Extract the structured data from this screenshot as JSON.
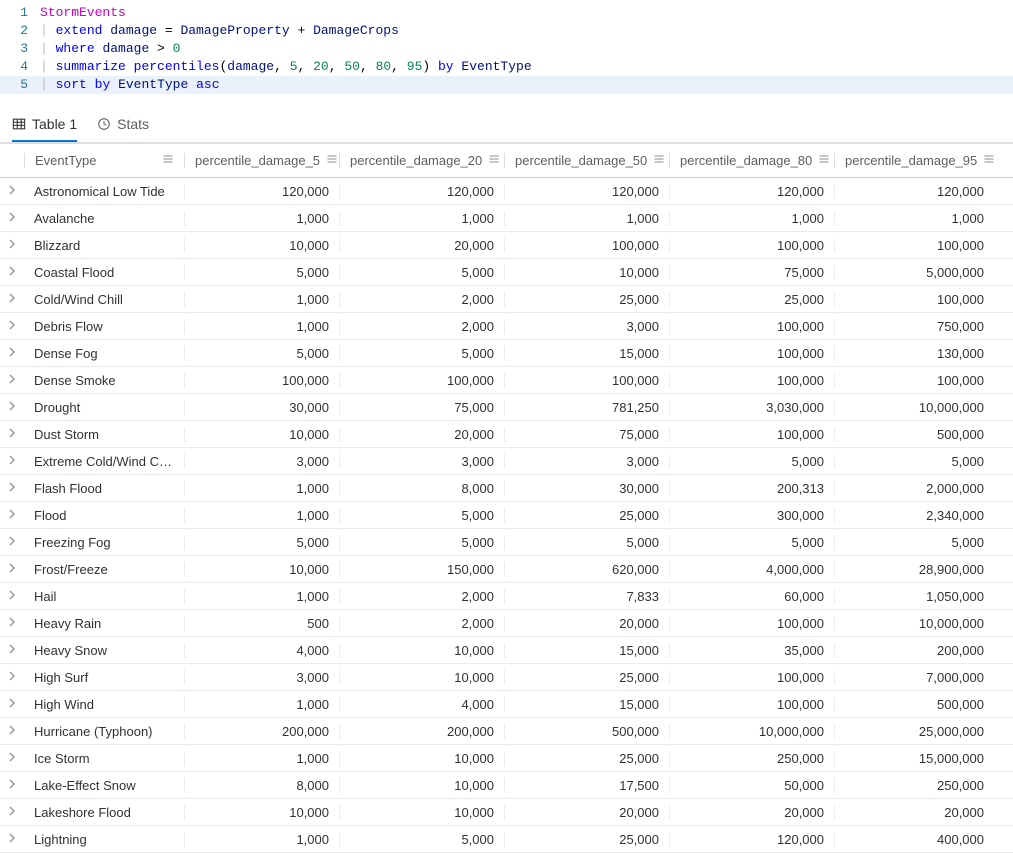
{
  "editor": {
    "lines": [
      {
        "n": "1",
        "tokens": [
          {
            "t": "StormEvents",
            "c": "tok-tbl"
          }
        ]
      },
      {
        "n": "2",
        "tokens": [
          {
            "t": "| ",
            "c": "tok-pipe"
          },
          {
            "t": "extend",
            "c": "tok-kw"
          },
          {
            "t": " ",
            "c": ""
          },
          {
            "t": "damage",
            "c": "tok-col"
          },
          {
            "t": " = ",
            "c": "tok-op"
          },
          {
            "t": "DamageProperty",
            "c": "tok-col"
          },
          {
            "t": " + ",
            "c": "tok-op"
          },
          {
            "t": "DamageCrops",
            "c": "tok-col"
          }
        ]
      },
      {
        "n": "3",
        "tokens": [
          {
            "t": "| ",
            "c": "tok-pipe"
          },
          {
            "t": "where",
            "c": "tok-kw"
          },
          {
            "t": " ",
            "c": ""
          },
          {
            "t": "damage",
            "c": "tok-col"
          },
          {
            "t": " > ",
            "c": "tok-op"
          },
          {
            "t": "0",
            "c": "tok-num"
          }
        ]
      },
      {
        "n": "4",
        "tokens": [
          {
            "t": "| ",
            "c": "tok-pipe"
          },
          {
            "t": "summarize",
            "c": "tok-kw"
          },
          {
            "t": " ",
            "c": ""
          },
          {
            "t": "percentiles",
            "c": "tok-fn"
          },
          {
            "t": "(",
            "c": "tok-op"
          },
          {
            "t": "damage",
            "c": "tok-col"
          },
          {
            "t": ", ",
            "c": "tok-op"
          },
          {
            "t": "5",
            "c": "tok-num"
          },
          {
            "t": ", ",
            "c": "tok-op"
          },
          {
            "t": "20",
            "c": "tok-num"
          },
          {
            "t": ", ",
            "c": "tok-op"
          },
          {
            "t": "50",
            "c": "tok-num"
          },
          {
            "t": ", ",
            "c": "tok-op"
          },
          {
            "t": "80",
            "c": "tok-num"
          },
          {
            "t": ", ",
            "c": "tok-op"
          },
          {
            "t": "95",
            "c": "tok-num"
          },
          {
            "t": ") ",
            "c": "tok-op"
          },
          {
            "t": "by",
            "c": "tok-kw"
          },
          {
            "t": " ",
            "c": ""
          },
          {
            "t": "EventType",
            "c": "tok-col"
          }
        ]
      },
      {
        "n": "5",
        "current": true,
        "tokens": [
          {
            "t": "| ",
            "c": "tok-pipe"
          },
          {
            "t": "sort",
            "c": "tok-kw"
          },
          {
            "t": " ",
            "c": ""
          },
          {
            "t": "by",
            "c": "tok-kw"
          },
          {
            "t": " ",
            "c": ""
          },
          {
            "t": "EventType",
            "c": "tok-col"
          },
          {
            "t": " ",
            "c": ""
          },
          {
            "t": "asc",
            "c": "tok-kw"
          }
        ]
      }
    ]
  },
  "tabs": {
    "table": "Table 1",
    "stats": "Stats"
  },
  "table": {
    "columns": [
      "EventType",
      "percentile_damage_5",
      "percentile_damage_20",
      "percentile_damage_50",
      "percentile_damage_80",
      "percentile_damage_95"
    ],
    "rows": [
      [
        "Astronomical Low Tide",
        "120,000",
        "120,000",
        "120,000",
        "120,000",
        "120,000"
      ],
      [
        "Avalanche",
        "1,000",
        "1,000",
        "1,000",
        "1,000",
        "1,000"
      ],
      [
        "Blizzard",
        "10,000",
        "20,000",
        "100,000",
        "100,000",
        "100,000"
      ],
      [
        "Coastal Flood",
        "5,000",
        "5,000",
        "10,000",
        "75,000",
        "5,000,000"
      ],
      [
        "Cold/Wind Chill",
        "1,000",
        "2,000",
        "25,000",
        "25,000",
        "100,000"
      ],
      [
        "Debris Flow",
        "1,000",
        "2,000",
        "3,000",
        "100,000",
        "750,000"
      ],
      [
        "Dense Fog",
        "5,000",
        "5,000",
        "15,000",
        "100,000",
        "130,000"
      ],
      [
        "Dense Smoke",
        "100,000",
        "100,000",
        "100,000",
        "100,000",
        "100,000"
      ],
      [
        "Drought",
        "30,000",
        "75,000",
        "781,250",
        "3,030,000",
        "10,000,000"
      ],
      [
        "Dust Storm",
        "10,000",
        "20,000",
        "75,000",
        "100,000",
        "500,000"
      ],
      [
        "Extreme Cold/Wind Chill",
        "3,000",
        "3,000",
        "3,000",
        "5,000",
        "5,000"
      ],
      [
        "Flash Flood",
        "1,000",
        "8,000",
        "30,000",
        "200,313",
        "2,000,000"
      ],
      [
        "Flood",
        "1,000",
        "5,000",
        "25,000",
        "300,000",
        "2,340,000"
      ],
      [
        "Freezing Fog",
        "5,000",
        "5,000",
        "5,000",
        "5,000",
        "5,000"
      ],
      [
        "Frost/Freeze",
        "10,000",
        "150,000",
        "620,000",
        "4,000,000",
        "28,900,000"
      ],
      [
        "Hail",
        "1,000",
        "2,000",
        "7,833",
        "60,000",
        "1,050,000"
      ],
      [
        "Heavy Rain",
        "500",
        "2,000",
        "20,000",
        "100,000",
        "10,000,000"
      ],
      [
        "Heavy Snow",
        "4,000",
        "10,000",
        "15,000",
        "35,000",
        "200,000"
      ],
      [
        "High Surf",
        "3,000",
        "10,000",
        "25,000",
        "100,000",
        "7,000,000"
      ],
      [
        "High Wind",
        "1,000",
        "4,000",
        "15,000",
        "100,000",
        "500,000"
      ],
      [
        "Hurricane (Typhoon)",
        "200,000",
        "200,000",
        "500,000",
        "10,000,000",
        "25,000,000"
      ],
      [
        "Ice Storm",
        "1,000",
        "10,000",
        "25,000",
        "250,000",
        "15,000,000"
      ],
      [
        "Lake-Effect Snow",
        "8,000",
        "10,000",
        "17,500",
        "50,000",
        "250,000"
      ],
      [
        "Lakeshore Flood",
        "10,000",
        "10,000",
        "20,000",
        "20,000",
        "20,000"
      ],
      [
        "Lightning",
        "1,000",
        "5,000",
        "25,000",
        "120,000",
        "400,000"
      ]
    ]
  }
}
